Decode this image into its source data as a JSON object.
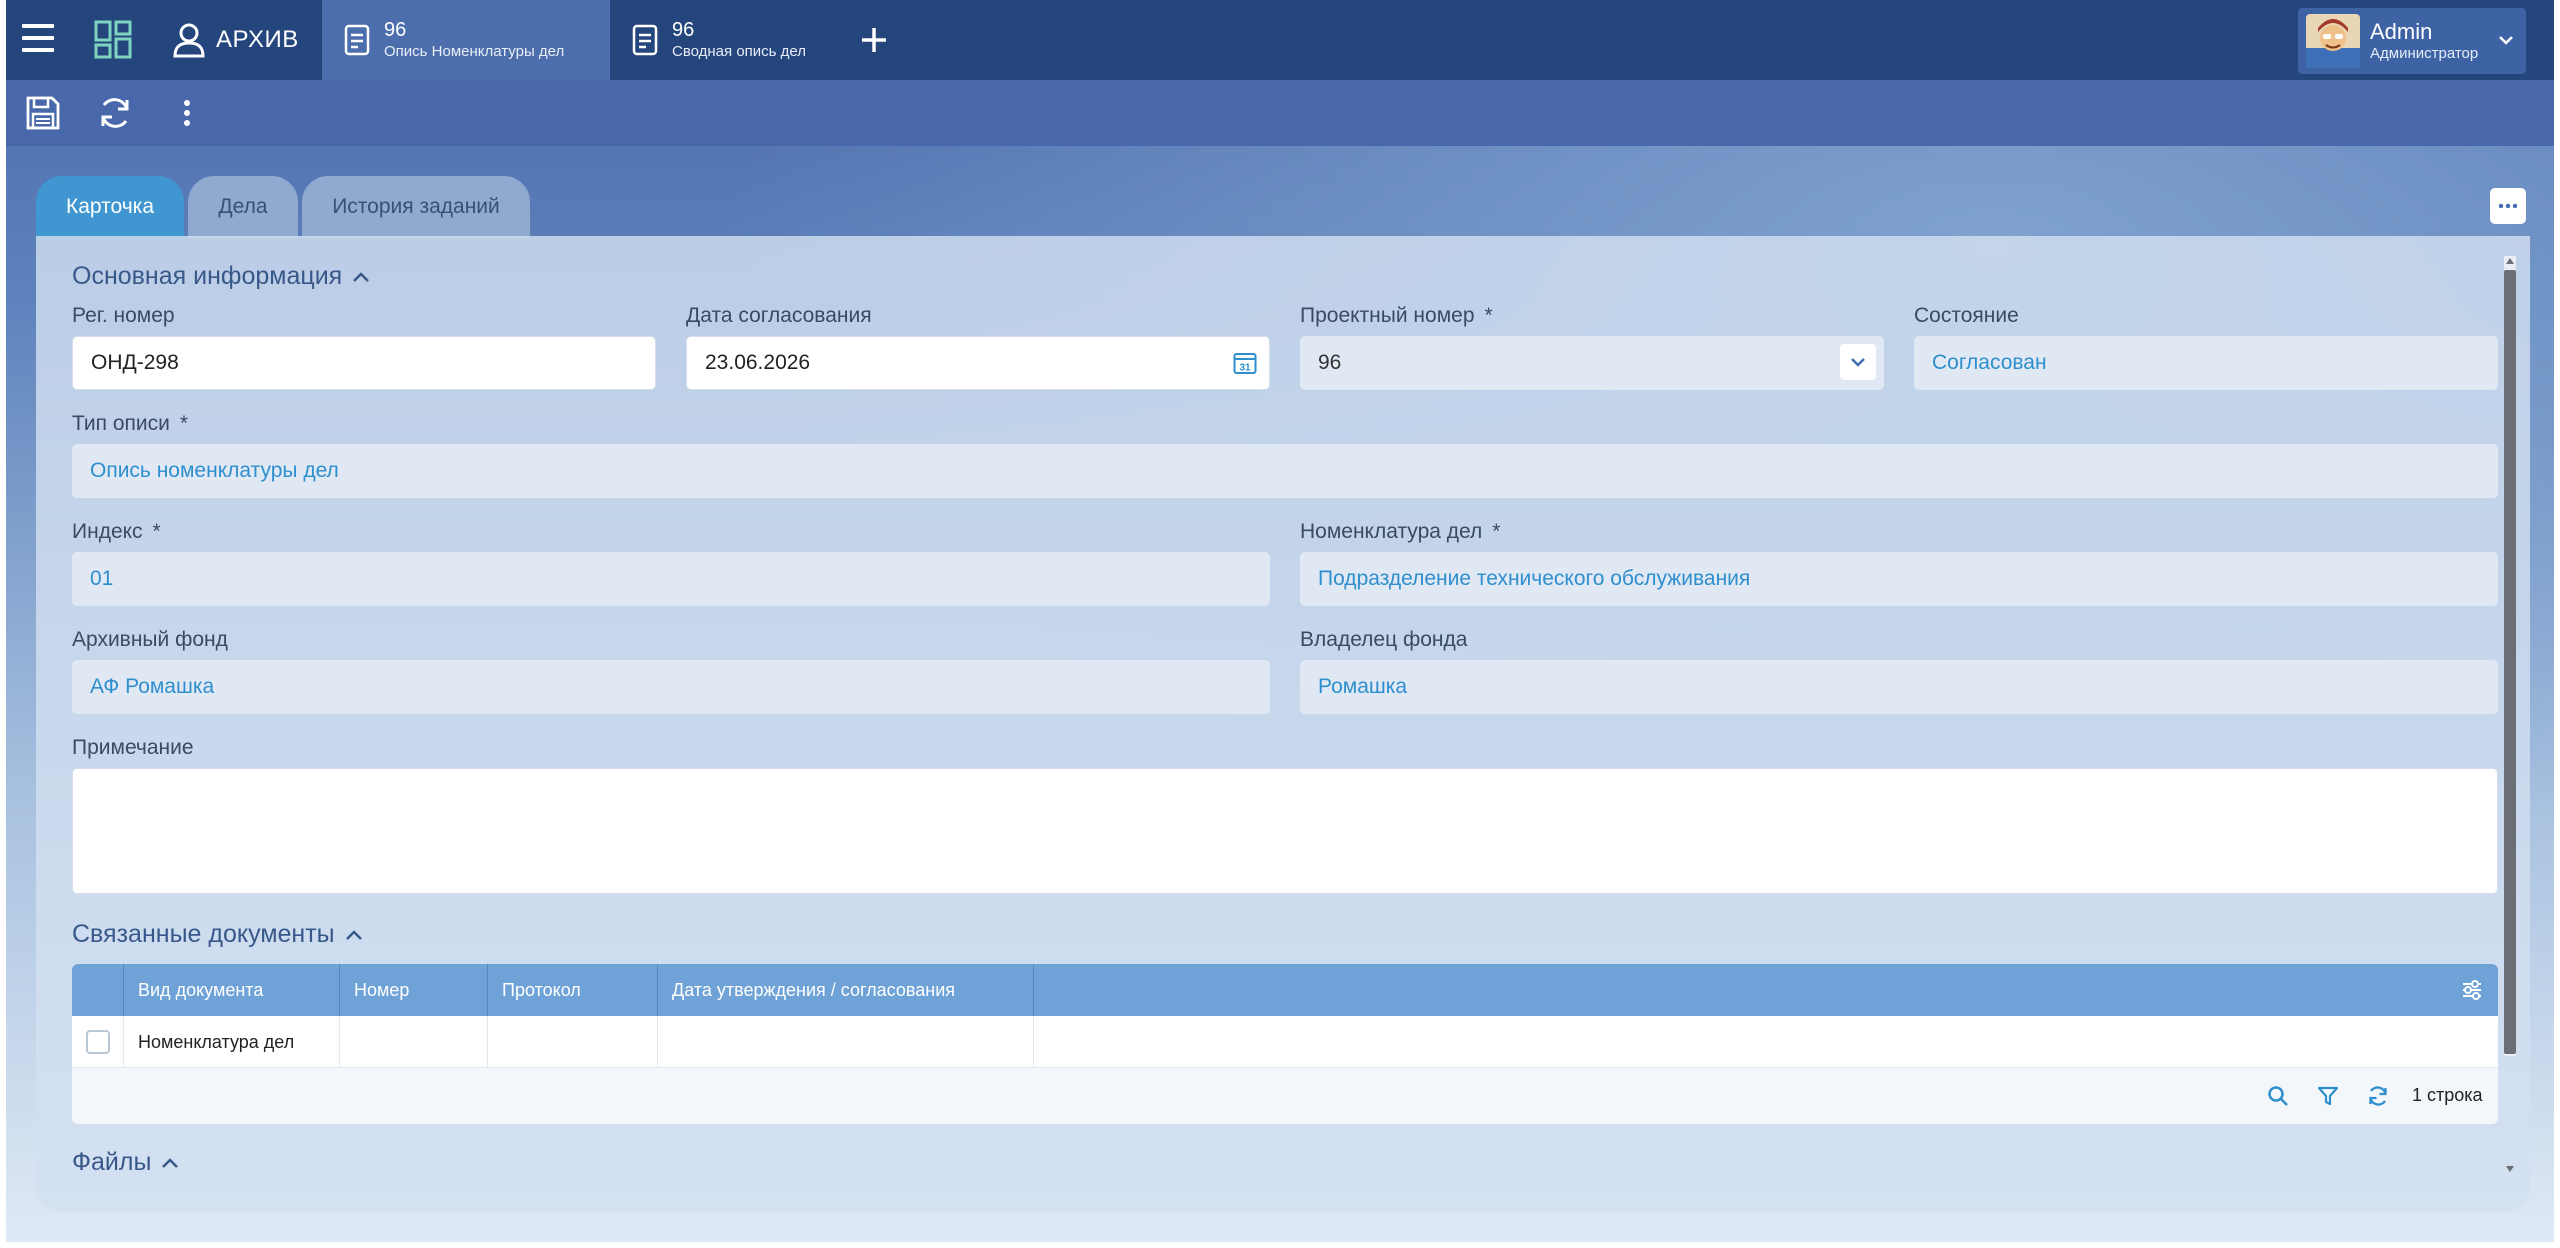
{
  "topbar": {
    "brand_label": "АРХИВ",
    "tabs": [
      {
        "number": "96",
        "title": "Опись Номенклатуры дел"
      },
      {
        "number": "96",
        "title": "Сводная опись дел"
      }
    ],
    "user": {
      "name": "Admin",
      "role": "Администратор"
    }
  },
  "page_tabs": [
    "Карточка",
    "Дела",
    "История заданий"
  ],
  "sections": {
    "main": "Основная информация",
    "related": "Связанные документы",
    "files": "Файлы"
  },
  "form": {
    "reg_number": {
      "label": "Рег. номер",
      "value": "ОНД-298"
    },
    "approval_date": {
      "label": "Дата согласования",
      "value": "23.06.2026",
      "calendar_icon_text": "31"
    },
    "project_number": {
      "label": "Проектный номер",
      "value": "96"
    },
    "state": {
      "label": "Состояние",
      "value": "Согласован"
    },
    "inventory_type": {
      "label": "Тип описи",
      "value": "Опись номенклатуры дел"
    },
    "index": {
      "label": "Индекс",
      "value": "01"
    },
    "nomenclature": {
      "label": "Номенклатура дел",
      "value": "Подразделение технического обслуживания"
    },
    "archive_fund": {
      "label": "Архивный фонд",
      "value": "АФ Ромашка"
    },
    "fund_owner": {
      "label": "Владелец фонда",
      "value": "Ромашка"
    },
    "note": {
      "label": "Примечание",
      "value": ""
    },
    "required_mark": "*"
  },
  "related_table": {
    "columns": [
      "Вид документа",
      "Номер",
      "Протокол",
      "Дата утверждения / согласования"
    ],
    "rows": [
      [
        "Номенклатура дел",
        "",
        "",
        ""
      ]
    ],
    "row_count": "1 строка"
  },
  "colors": {
    "topbar": "#25457d",
    "active_tab": "#3f96d0",
    "table_header": "#6fa3d8",
    "link_value": "#2f8fce"
  }
}
